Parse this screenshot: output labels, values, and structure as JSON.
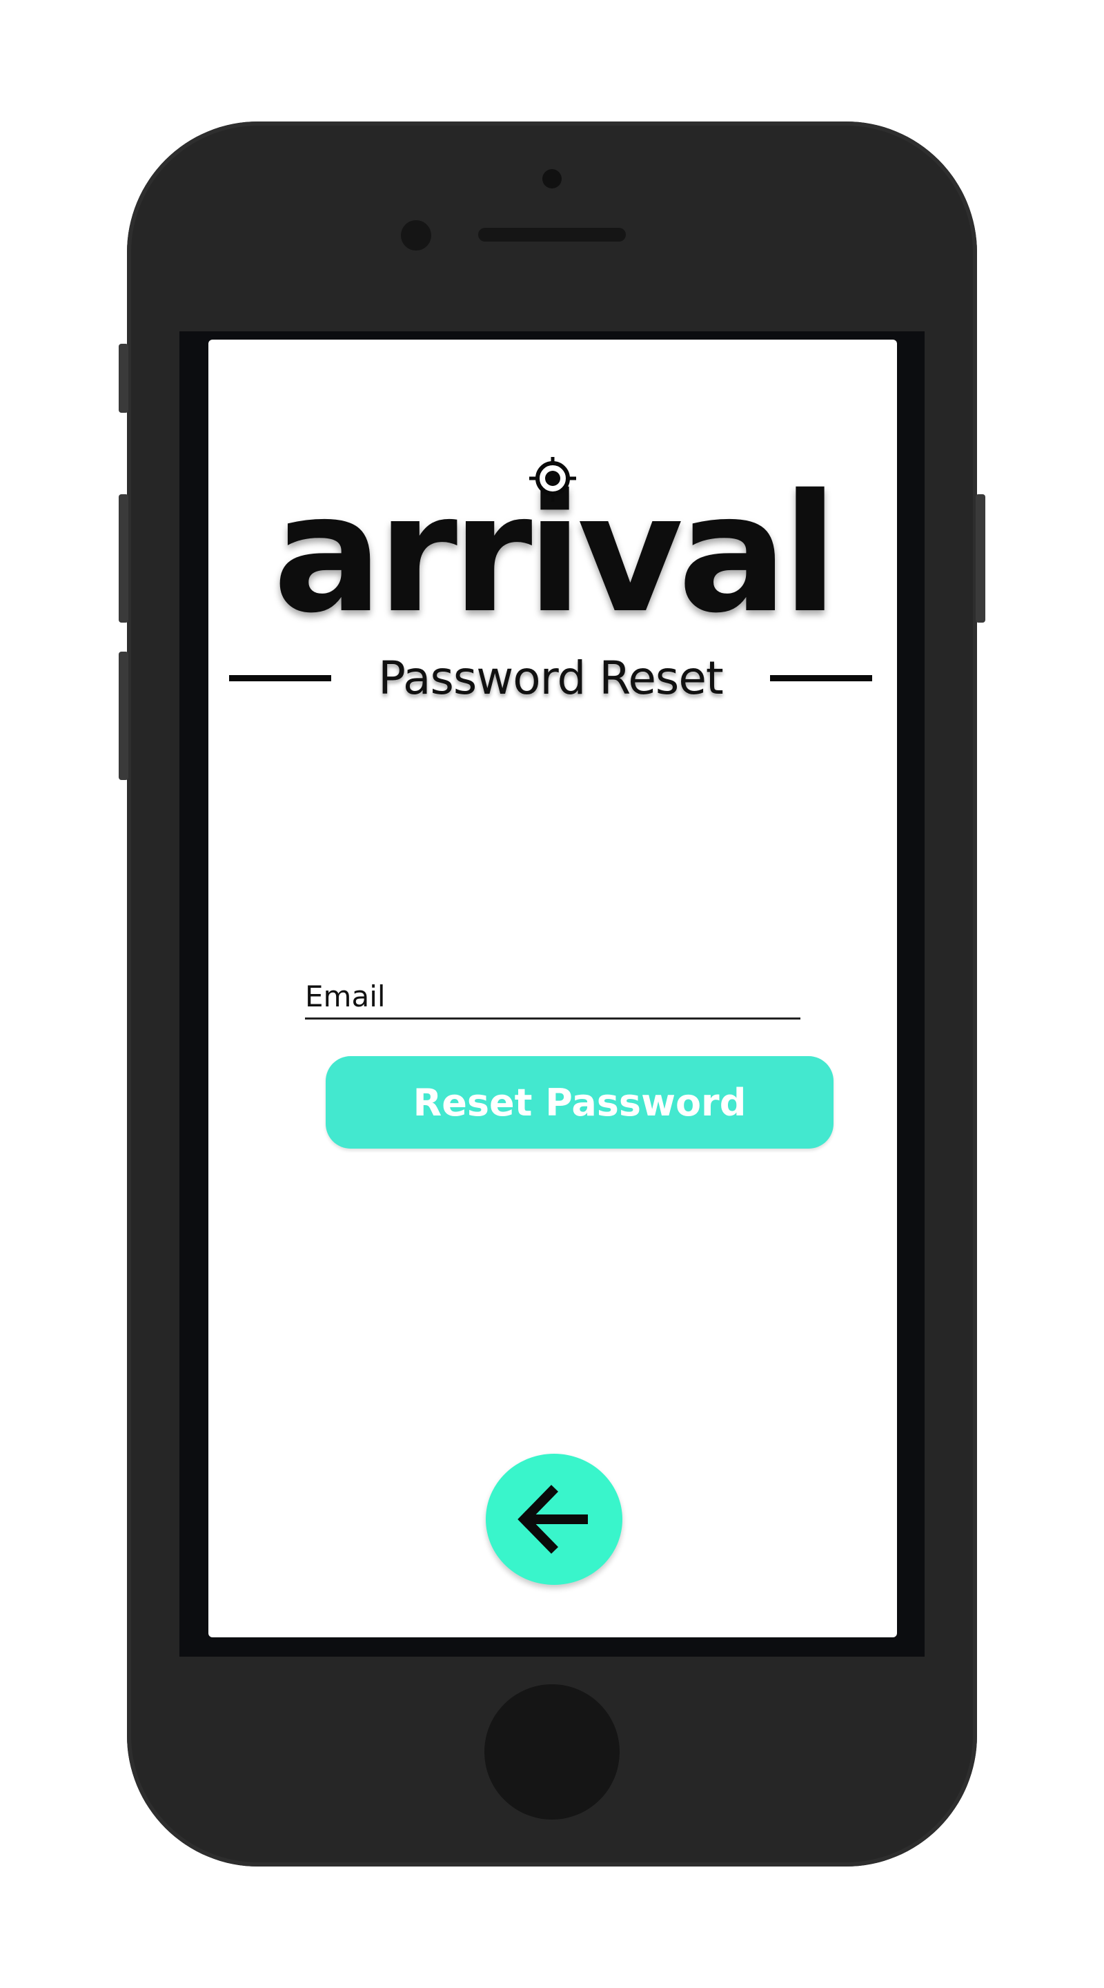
{
  "app": {
    "logo_text": "arrival",
    "logo_icon": "target-crosshair-icon",
    "subtitle": "Password Reset"
  },
  "form": {
    "email_placeholder": "Email",
    "email_value": "",
    "reset_button_label": "Reset Password"
  },
  "navigation": {
    "back_icon": "arrow-left-icon"
  },
  "colors": {
    "accent": "#43e8cf",
    "back_button": "#39f5cb",
    "device_body": "#262626",
    "text": "#111111"
  }
}
